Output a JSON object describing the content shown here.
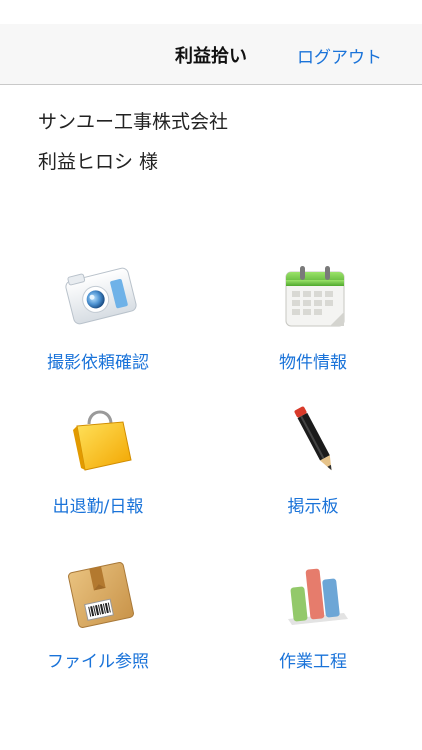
{
  "nav": {
    "title": "利益拾い",
    "logout_label": "ログアウト"
  },
  "user": {
    "company": "サンユー工事株式会社",
    "name": "利益ヒロシ 様"
  },
  "menu": [
    {
      "label": "撮影依頼確認",
      "icon": "camera-icon"
    },
    {
      "label": "物件情報",
      "icon": "calendar-icon"
    },
    {
      "label": "出退勤/日報",
      "icon": "shopping-bag-icon"
    },
    {
      "label": "掲示板",
      "icon": "pencil-icon"
    },
    {
      "label": "ファイル参照",
      "icon": "package-box-icon"
    },
    {
      "label": "作業工程",
      "icon": "bar-chart-icon"
    }
  ],
  "colors": {
    "link": "#1a73d9",
    "navbar_bg": "#f7f7f7"
  }
}
